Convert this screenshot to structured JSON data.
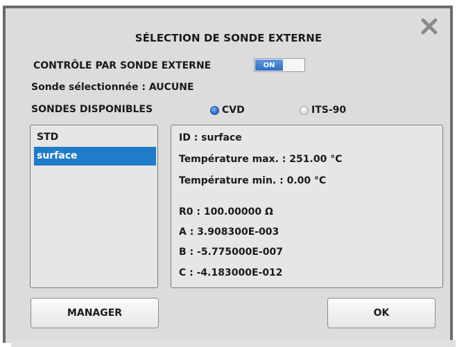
{
  "dialog": {
    "title": "SÉLECTION  DE SONDE EXTERNE",
    "close_icon": "close-x-icon"
  },
  "external_control": {
    "label": "CONTRÔLE PAR SONDE EXTERNE",
    "toggle_on_label": "ON",
    "state": "on",
    "accent_color": "#2f6fc4"
  },
  "selected_probe": {
    "text": "Sonde sélectionnée : AUCUNE"
  },
  "available": {
    "label": "SONDES DISPONIBLES",
    "radio_options": [
      {
        "label": "CVD",
        "selected": true
      },
      {
        "label": "ITS-90",
        "selected": false
      }
    ]
  },
  "probe_list": {
    "items": [
      "STD",
      "surface"
    ],
    "selected_index": 1,
    "selected_color": "#1f7cc8"
  },
  "probe_details": {
    "id": "ID : surface",
    "temp_max": "Température max. : 251.00 °C",
    "temp_min": "Température min. : 0.00 °C",
    "r0": "R0 : 100.00000 Ω",
    "a": "A : 3.908300E-003",
    "b": "B : -5.775000E-007",
    "c": "C : -4.183000E-012"
  },
  "buttons": {
    "manager_label": "MANAGER",
    "ok_label": "OK"
  }
}
